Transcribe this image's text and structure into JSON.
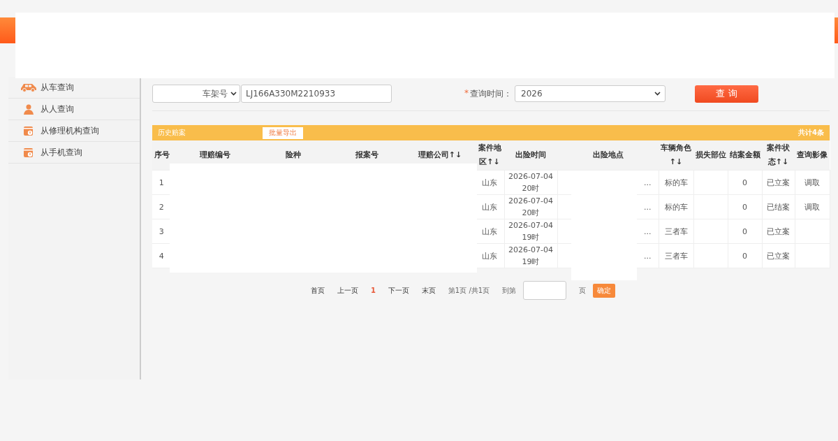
{
  "sidebar": {
    "items": [
      {
        "label": "从车查询"
      },
      {
        "label": "从人查询"
      },
      {
        "label": "从修理机构查询"
      },
      {
        "label": "从手机查询"
      }
    ]
  },
  "search": {
    "id_type": "车架号",
    "id_value": "LJ166A330M2210933",
    "time_required_mark": "*",
    "time_label": "查询时间：",
    "time_value": "2026",
    "button": "查 询"
  },
  "table": {
    "title": "历史赔案",
    "export_button": "批量导出",
    "total": "共计4条",
    "columns": [
      {
        "label": "序号"
      },
      {
        "label": "理赔编号"
      },
      {
        "label": "险种"
      },
      {
        "label": "报案号"
      },
      {
        "label": "理赔公司↑↓"
      },
      {
        "label": "案件地区↑↓"
      },
      {
        "label": "出险时间"
      },
      {
        "label": "出险地点"
      },
      {
        "label": "车辆角色↑↓"
      },
      {
        "label": "损失部位"
      },
      {
        "label": "结案金额"
      },
      {
        "label": "案件状态↑↓"
      },
      {
        "label": "查询影像"
      }
    ],
    "rows": [
      {
        "index": "1",
        "region": "山东",
        "time": "2026-07-04 20时",
        "place": "...",
        "role": "标的车",
        "amount": "0",
        "status": "已立案",
        "image_link": "调取"
      },
      {
        "index": "2",
        "region": "山东",
        "time": "2026-07-04 20时",
        "place": "...",
        "role": "标的车",
        "amount": "0",
        "status": "已结案",
        "image_link": "调取"
      },
      {
        "index": "3",
        "region": "山东",
        "time": "2026-07-04 19时",
        "place": "...",
        "role": "三者车",
        "amount": "0",
        "status": "已立案"
      },
      {
        "index": "4",
        "region": "山东",
        "time": "2026-07-04 19时",
        "place": "...",
        "role": "三者车",
        "amount": "0",
        "status": "已立案"
      }
    ]
  },
  "pager": {
    "first": "首页",
    "prev": "上一页",
    "pages": [
      {
        "label": "1",
        "selected": true
      }
    ],
    "next": "下一页",
    "last": "末页",
    "summary": "第1页 /共1页",
    "goto_label": "到第",
    "goto_suffix": "页",
    "confirm": "确定"
  }
}
